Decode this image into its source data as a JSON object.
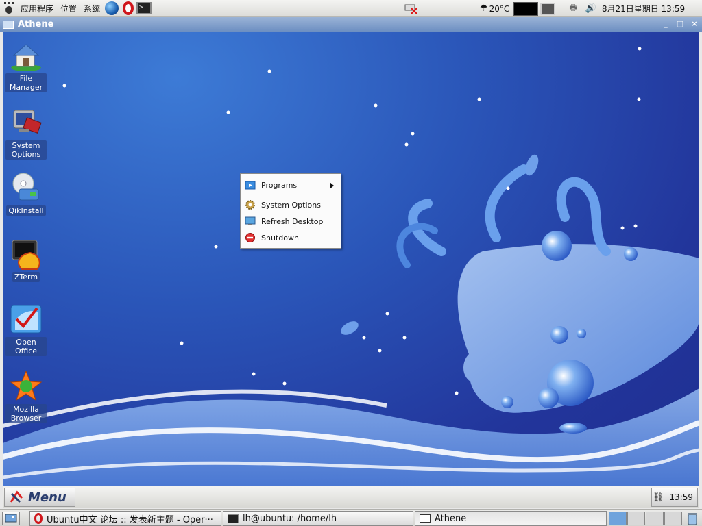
{
  "top_panel": {
    "menus": [
      "应用程序",
      "位置",
      "系统"
    ],
    "weather": "20°C",
    "datetime": "8月21日星期日 13:59",
    "icons": [
      "gnome-foot-icon",
      "firefox-globe-icon",
      "opera-icon",
      "terminal-icon",
      "network-disconnected-icon",
      "weather-icon",
      "system-monitor-icon",
      "display-icon",
      "printer-icon",
      "volume-icon"
    ]
  },
  "window": {
    "title": "Athene",
    "controls": [
      "_",
      "□",
      "×"
    ]
  },
  "desktop_icons": [
    {
      "name": "desktop-icon-file-manager",
      "label": "File Manager",
      "icon": "house-icon"
    },
    {
      "name": "desktop-icon-system-options",
      "label": "System Options",
      "icon": "monitor-tools-icon"
    },
    {
      "name": "desktop-icon-qikinstall",
      "label": "QikInstall",
      "icon": "disc-install-icon"
    },
    {
      "name": "desktop-icon-zterm",
      "label": "ZTerm",
      "icon": "shell-terminal-icon"
    },
    {
      "name": "desktop-icon-open-office",
      "label": "Open Office",
      "icon": "office-icon"
    },
    {
      "name": "desktop-icon-mozilla-browser",
      "label": "Mozilla Browser",
      "icon": "mozilla-icon"
    }
  ],
  "context_menu": {
    "items": [
      {
        "label": "Programs",
        "icon": "folder-icon",
        "submenu": true
      },
      {
        "label": "System Options",
        "icon": "gear-icon"
      },
      {
        "label": "Refresh Desktop",
        "icon": "monitor-icon"
      },
      {
        "label": "Shutdown",
        "icon": "stop-icon"
      }
    ]
  },
  "athene_bar": {
    "menu_label": "Menu",
    "clock": "13:59"
  },
  "bottom_panel": {
    "tasks": [
      {
        "label": "Ubuntu中文 论坛 :: 发表新主题 - Oper···",
        "icon": "opera-icon"
      },
      {
        "label": "lh@ubuntu: /home/lh",
        "icon": "terminal-icon"
      },
      {
        "label": "Athene",
        "icon": "window-icon"
      }
    ],
    "workspaces": 4,
    "active_workspace": 1
  },
  "colors": {
    "desktop_blue": "#2a55b8",
    "titlebar": "#6d8fc2",
    "workspace_active": "#6fa3dc"
  }
}
